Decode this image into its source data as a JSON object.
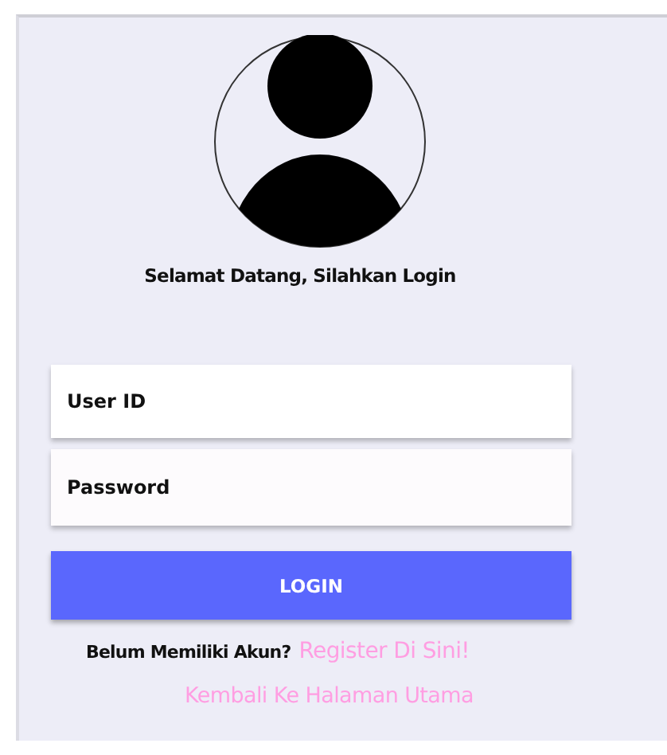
{
  "greeting": "Selamat Datang, Silahkan Login",
  "fields": [
    {
      "placeholder": "User ID",
      "kind": "text"
    },
    {
      "placeholder": "Password",
      "kind": "password"
    }
  ],
  "login_button": "LOGIN",
  "register_prompt": "Belum Memiliki Akun?",
  "register_link": "Register Di Sini!",
  "home_link": "Kembali Ke Halaman Utama"
}
